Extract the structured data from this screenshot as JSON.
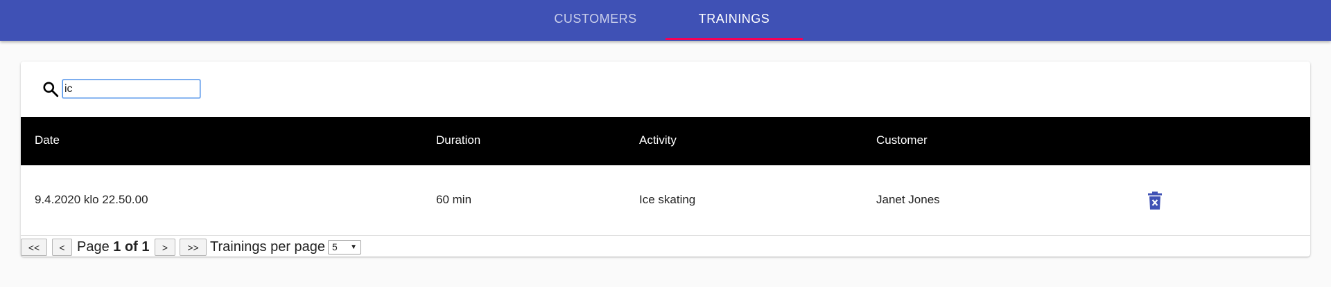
{
  "nav": {
    "tabs": [
      {
        "label": "CUSTOMERS",
        "active": false
      },
      {
        "label": "TRAININGS",
        "active": true
      }
    ],
    "bar_color": "#3f51b5",
    "indicator_color": "#f50057"
  },
  "search": {
    "icon": "search-icon",
    "value": "ic"
  },
  "table": {
    "headers": [
      "Date",
      "Duration",
      "Activity",
      "Customer"
    ],
    "rows": [
      {
        "date": "9.4.2020 klo 22.50.00",
        "duration": "60 min",
        "activity": "Ice skating",
        "customer": "Janet Jones",
        "action_icon": "delete-icon"
      }
    ]
  },
  "pagination": {
    "first_label": "<<",
    "prev_label": "<",
    "page_prefix": "Page",
    "page_current": "1 of 1",
    "next_label": ">",
    "last_label": ">>",
    "per_page_label": "Trainings per page",
    "per_page_value": "5"
  }
}
